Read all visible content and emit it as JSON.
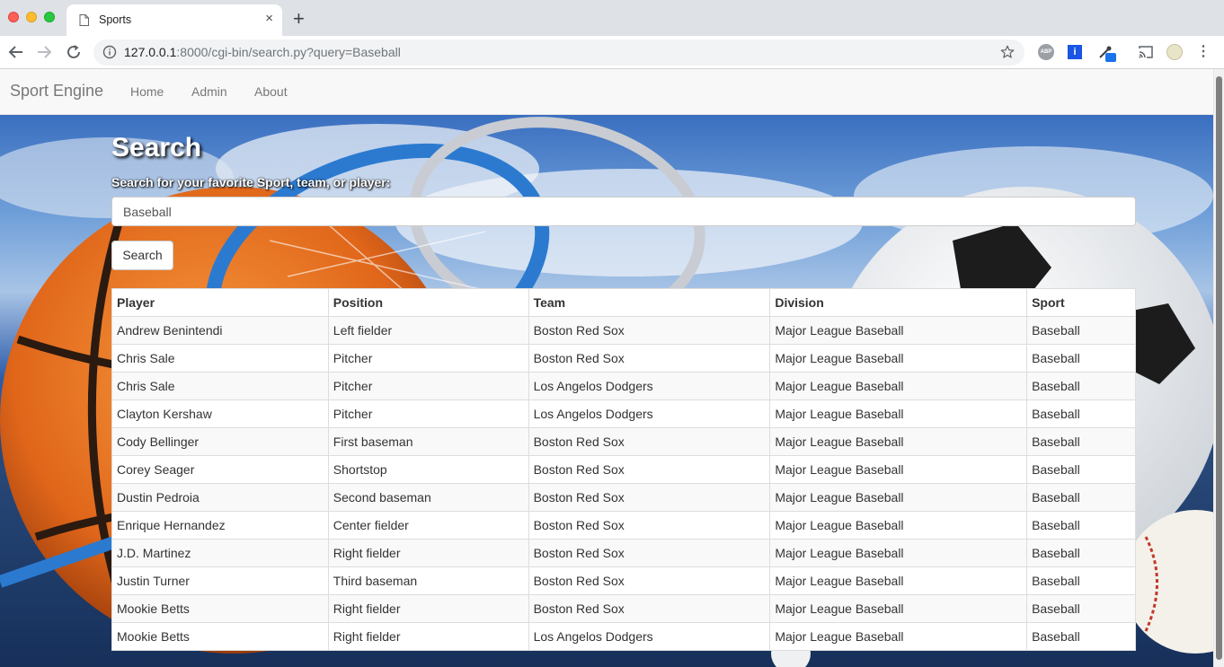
{
  "browser": {
    "tab_title": "Sports",
    "tab_close": "×",
    "new_tab": "+",
    "url_host": "127.0.0.1",
    "url_rest": ":8000/cgi-bin/search.py?query=Baseball",
    "extensions": {
      "abp_label": "ABP",
      "info_label": "i",
      "menu_label": "⋮"
    }
  },
  "navbar": {
    "brand": "Sport Engine",
    "links": [
      "Home",
      "Admin",
      "About"
    ]
  },
  "search": {
    "heading": "Search",
    "label": "Search for your favorite Sport, team, or player:",
    "value": "Baseball",
    "button_label": "Search"
  },
  "results": {
    "headers": [
      "Player",
      "Position",
      "Team",
      "Division",
      "Sport"
    ],
    "rows": [
      [
        "Andrew Benintendi",
        "Left fielder",
        "Boston Red Sox",
        "Major League Baseball",
        "Baseball"
      ],
      [
        "Chris Sale",
        "Pitcher",
        "Boston Red Sox",
        "Major League Baseball",
        "Baseball"
      ],
      [
        "Chris Sale",
        "Pitcher",
        "Los Angelos Dodgers",
        "Major League Baseball",
        "Baseball"
      ],
      [
        "Clayton Kershaw",
        "Pitcher",
        "Los Angelos Dodgers",
        "Major League Baseball",
        "Baseball"
      ],
      [
        "Cody Bellinger",
        "First baseman",
        "Boston Red Sox",
        "Major League Baseball",
        "Baseball"
      ],
      [
        "Corey Seager",
        "Shortstop",
        "Boston Red Sox",
        "Major League Baseball",
        "Baseball"
      ],
      [
        "Dustin Pedroia",
        "Second baseman",
        "Boston Red Sox",
        "Major League Baseball",
        "Baseball"
      ],
      [
        "Enrique Hernandez",
        "Center fielder",
        "Boston Red Sox",
        "Major League Baseball",
        "Baseball"
      ],
      [
        "J.D. Martinez",
        "Right fielder",
        "Boston Red Sox",
        "Major League Baseball",
        "Baseball"
      ],
      [
        "Justin Turner",
        "Third baseman",
        "Boston Red Sox",
        "Major League Baseball",
        "Baseball"
      ],
      [
        "Mookie Betts",
        "Right fielder",
        "Boston Red Sox",
        "Major League Baseball",
        "Baseball"
      ],
      [
        "Mookie Betts",
        "Right fielder",
        "Los Angelos Dodgers",
        "Major League Baseball",
        "Baseball"
      ]
    ]
  }
}
